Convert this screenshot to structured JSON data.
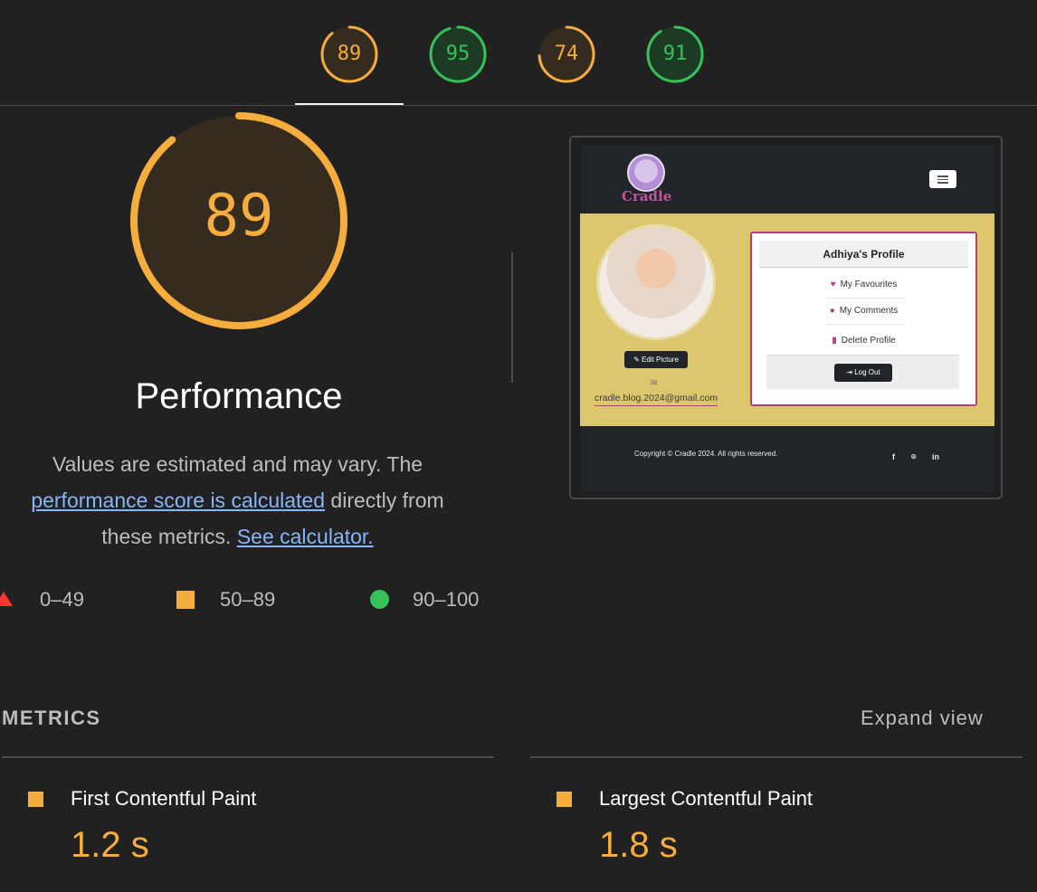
{
  "scores": {
    "tabs": [
      {
        "value": "89",
        "level": "average"
      },
      {
        "value": "95",
        "level": "pass"
      },
      {
        "value": "74",
        "level": "average"
      },
      {
        "value": "91",
        "level": "pass"
      }
    ],
    "active_tab": 0
  },
  "colors": {
    "average": "#f5ad3d",
    "average_bg": "#352b1e",
    "pass": "#35c25a",
    "pass_bg": "#1d3a25",
    "fail": "#f33a2f",
    "link": "#8ab4f8"
  },
  "main_gauge": {
    "value": "89",
    "category": "Performance"
  },
  "description": {
    "text_before": "Values are estimated and may vary. The ",
    "link_score": "performance score is calculated",
    "text_middle": " directly from these metrics. ",
    "link_calculator": "See calculator."
  },
  "legend": [
    {
      "range": "0–49",
      "shape": "triangle"
    },
    {
      "range": "50–89",
      "shape": "square"
    },
    {
      "range": "90–100",
      "shape": "circle"
    }
  ],
  "screenshot": {
    "logo_text": "Cradle",
    "profile_title": "Adhiya's Profile",
    "menu_items": [
      {
        "icon": "heart-icon",
        "glyph": "♥",
        "label": "My Favourites"
      },
      {
        "icon": "comment-icon",
        "glyph": "●",
        "label": "My Comments"
      },
      {
        "icon": "trash-icon",
        "glyph": "▮",
        "label": "Delete Profile"
      }
    ],
    "edit_picture_label": "Edit Picture",
    "logout_label": "Log Out",
    "email": "cradle.blog.2024@gmail.com",
    "footer_text": "Copyright © Cradle 2024. All rights reserved.",
    "social": [
      "f",
      "⌾",
      "in"
    ]
  },
  "metrics": {
    "heading": "METRICS",
    "expand_label": "Expand view",
    "items": [
      {
        "name": "First Contentful Paint",
        "value": "1.2 s",
        "level": "average"
      },
      {
        "name": "Largest Contentful Paint",
        "value": "1.8 s",
        "level": "average"
      }
    ]
  }
}
